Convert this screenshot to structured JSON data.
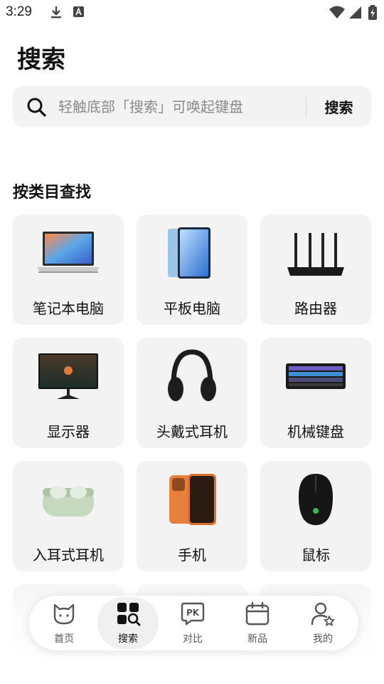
{
  "status_bar": {
    "time": "3:29"
  },
  "page": {
    "title": "搜索"
  },
  "search": {
    "placeholder": "轻触底部「搜索」可唤起键盘",
    "button_label": "搜索"
  },
  "categories_section": {
    "title": "按类目查找",
    "items": [
      {
        "label": "笔记本电脑",
        "icon": "laptop-icon"
      },
      {
        "label": "平板电脑",
        "icon": "tablet-icon"
      },
      {
        "label": "路由器",
        "icon": "router-icon"
      },
      {
        "label": "显示器",
        "icon": "monitor-icon"
      },
      {
        "label": "头戴式耳机",
        "icon": "headphones-icon"
      },
      {
        "label": "机械键盘",
        "icon": "keyboard-icon"
      },
      {
        "label": "入耳式耳机",
        "icon": "earbuds-icon"
      },
      {
        "label": "手机",
        "icon": "phone-icon"
      },
      {
        "label": "鼠标",
        "icon": "mouse-icon"
      }
    ]
  },
  "bottom_nav": {
    "active": "搜索",
    "items": [
      {
        "label": "首页",
        "icon": "cat-face-icon"
      },
      {
        "label": "搜索",
        "icon": "grid-search-icon"
      },
      {
        "label": "对比",
        "icon": "pk-compare-icon"
      },
      {
        "label": "新品",
        "icon": "calendar-icon"
      },
      {
        "label": "我的",
        "icon": "profile-star-icon"
      }
    ]
  }
}
